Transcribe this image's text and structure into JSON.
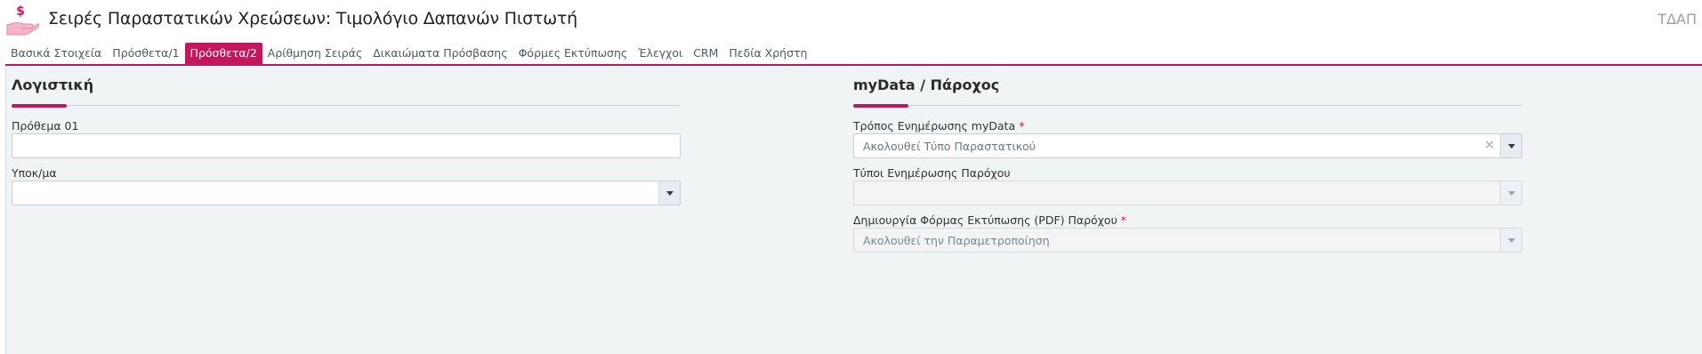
{
  "header": {
    "title": "Σειρές Παραστατικών Χρεώσεων: Τιμολόγιο Δαπανών Πιστωτή",
    "code": "ΤΔΑΠ",
    "icon": "hand-dollar-icon"
  },
  "tabs": [
    {
      "label": "Βασικά Στοιχεία",
      "active": false
    },
    {
      "label": "Πρόσθετα/1",
      "active": false
    },
    {
      "label": "Πρόσθετα/2",
      "active": true
    },
    {
      "label": "Αρίθμηση Σειράς",
      "active": false
    },
    {
      "label": "Δικαιώματα Πρόσβασης",
      "active": false
    },
    {
      "label": "Φόρμες Εκτύπωσης",
      "active": false
    },
    {
      "label": "Έλεγχοι",
      "active": false
    },
    {
      "label": "CRM",
      "active": false
    },
    {
      "label": "Πεδία Χρήστη",
      "active": false
    }
  ],
  "colors": {
    "accent": "#c2185b",
    "background": "#f1f4f5"
  },
  "accounting": {
    "title": "Λογιστική",
    "prefix_label": "Πρόθεμα 01",
    "prefix_value": "",
    "branch_label": "Υποκ/μα",
    "branch_value": ""
  },
  "mydata": {
    "title": "myData / Πάροχος",
    "update_mode_label": "Τρόπος Ενημέρωσης myData",
    "update_mode_required": "*",
    "update_mode_value": "Ακολουθεί Τύπο Παραστατικού",
    "provider_types_label": "Τύποι Ενημέρωσης Παρόχου",
    "provider_types_value": "",
    "pdf_label": "Δημιουργία Φόρμας Εκτύπωσης (PDF) Παρόχου",
    "pdf_required": "*",
    "pdf_value": "Ακολουθεί την Παραμετροποίηση"
  }
}
